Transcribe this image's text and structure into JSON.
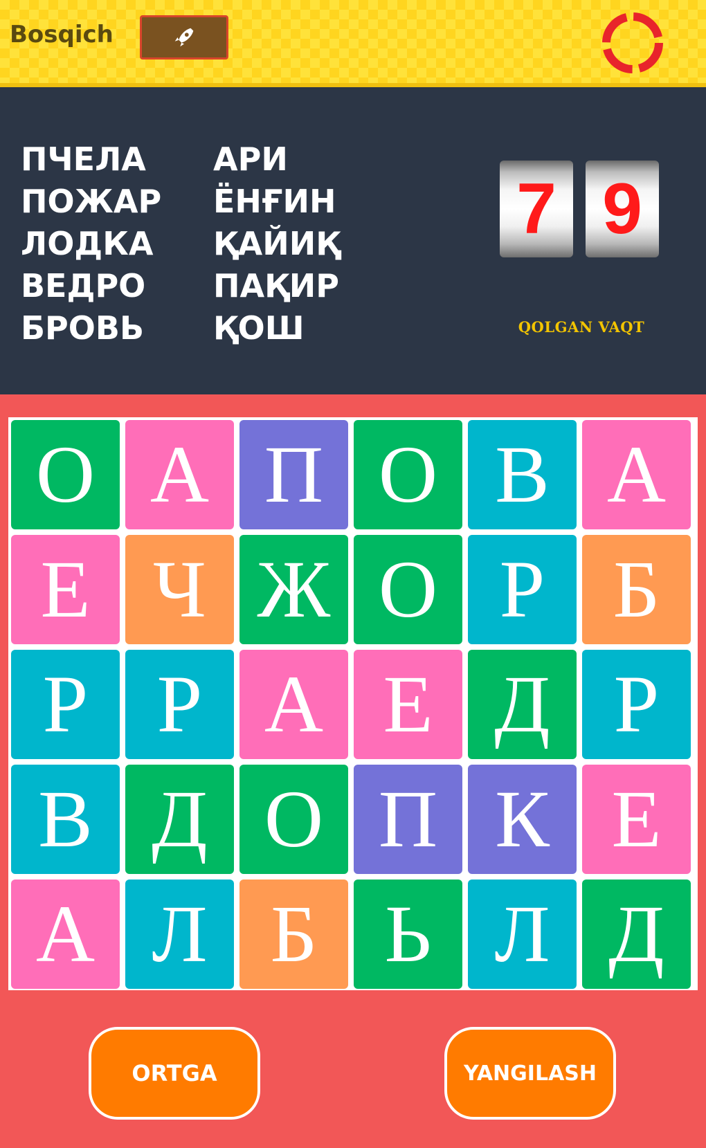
{
  "header": {
    "stage_label": "Bosqich",
    "stage_icon": "rocket-icon",
    "timer_icon": "timer-ring-icon",
    "colors": {
      "background": "#ffe23a",
      "stage_box": "#7a5220",
      "ring": "#e8242b"
    }
  },
  "words": {
    "ru": [
      "ПЧЕЛА",
      "ПОЖАР",
      "ЛОДКА",
      "ВЕДРО",
      "БРОВЬ"
    ],
    "uz": [
      "АРИ",
      "ЁНҒИН",
      "ҚАЙИҚ",
      "ПАҚИР",
      "ҚОШ"
    ]
  },
  "timer": {
    "digits": [
      "7",
      "9"
    ],
    "label": "QOLGAN VAQT"
  },
  "grid": {
    "rows": [
      [
        {
          "letter": "О",
          "color": "#00b862"
        },
        {
          "letter": "А",
          "color": "#ff6eb8"
        },
        {
          "letter": "П",
          "color": "#7472d8"
        },
        {
          "letter": "О",
          "color": "#00b862"
        },
        {
          "letter": "В",
          "color": "#00b6cc"
        },
        {
          "letter": "А",
          "color": "#ff6eb8"
        }
      ],
      [
        {
          "letter": "Е",
          "color": "#ff6eb8"
        },
        {
          "letter": "Ч",
          "color": "#ff9a52"
        },
        {
          "letter": "Ж",
          "color": "#00b862"
        },
        {
          "letter": "О",
          "color": "#00b862"
        },
        {
          "letter": "Р",
          "color": "#00b6cc"
        },
        {
          "letter": "Б",
          "color": "#ff9a52"
        }
      ],
      [
        {
          "letter": "Р",
          "color": "#00b6cc"
        },
        {
          "letter": "Р",
          "color": "#00b6cc"
        },
        {
          "letter": "А",
          "color": "#ff6eb8"
        },
        {
          "letter": "Е",
          "color": "#ff6eb8"
        },
        {
          "letter": "Д",
          "color": "#00b862"
        },
        {
          "letter": "Р",
          "color": "#00b6cc"
        }
      ],
      [
        {
          "letter": "В",
          "color": "#00b6cc"
        },
        {
          "letter": "Д",
          "color": "#00b862"
        },
        {
          "letter": "О",
          "color": "#00b862"
        },
        {
          "letter": "П",
          "color": "#7472d8"
        },
        {
          "letter": "К",
          "color": "#7472d8"
        },
        {
          "letter": "Е",
          "color": "#ff6eb8"
        }
      ],
      [
        {
          "letter": "А",
          "color": "#ff6eb8"
        },
        {
          "letter": "Л",
          "color": "#00b6cc"
        },
        {
          "letter": "Б",
          "color": "#ff9a52"
        },
        {
          "letter": "Ь",
          "color": "#00b862"
        },
        {
          "letter": "Л",
          "color": "#00b6cc"
        },
        {
          "letter": "Д",
          "color": "#00b862"
        }
      ]
    ]
  },
  "buttons": {
    "back_label": "ORTGA",
    "refresh_label": "YANGILASH",
    "color": "#ff7b00"
  }
}
